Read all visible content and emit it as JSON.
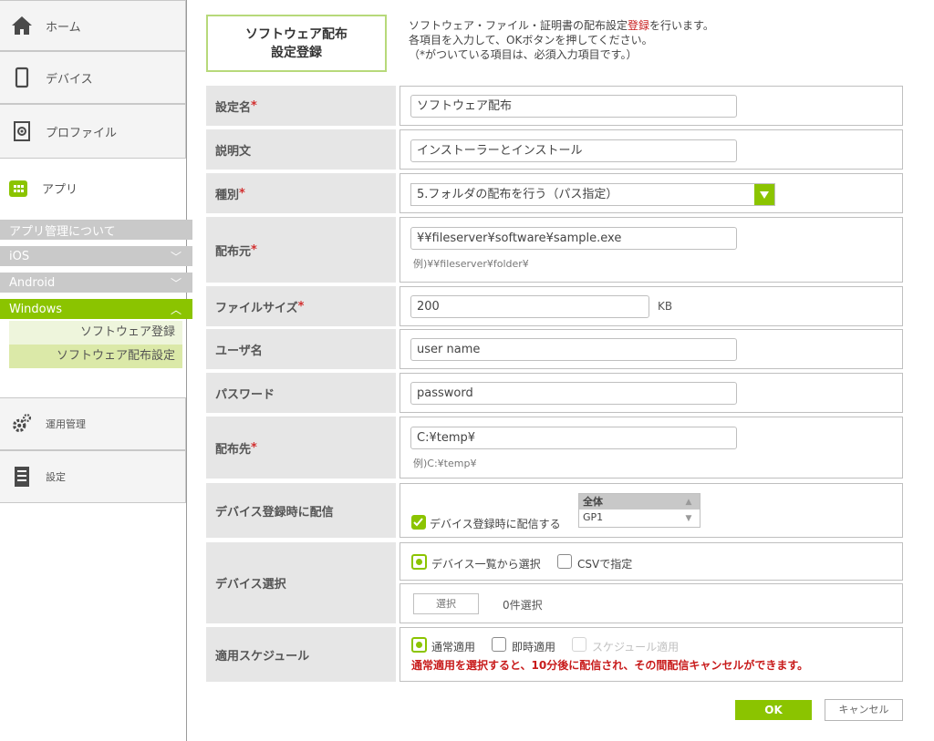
{
  "sidebar": {
    "home_label": "ホーム",
    "device_label": "デバイス",
    "profile_label": "プロファイル",
    "app_label": "アプリ",
    "app_items": [
      {
        "label": "アプリ管理について"
      },
      {
        "label": "iOS"
      },
      {
        "label": "Android"
      },
      {
        "label": "Windows"
      }
    ],
    "windows_sub": [
      {
        "label": "ソフトウェア登録"
      },
      {
        "label": "ソフトウェア配布設定"
      }
    ],
    "operation_label": "運用管理",
    "settings_label": "設定",
    "accent_color": "#8bc400"
  },
  "header": {
    "title_line1": "ソフトウェア配布",
    "title_line2": "設定登録",
    "intro_line1_pre": "ソフトウェア・ファイル・証明書の配布設定",
    "intro_line1_red": "登録",
    "intro_line1_post": "を行います。",
    "intro_line2": "各項目を入力して、OKボタンを押してください。",
    "intro_line3": "（*がついている項目は、必須入力項目です。）"
  },
  "form": {
    "setting_name": {
      "label": "設定名",
      "required": "*",
      "value": "ソフトウェア配布"
    },
    "description": {
      "label": "説明文",
      "value": "インストーラーとインストール"
    },
    "type": {
      "label": "種別",
      "required": "*",
      "value": "5.フォルダの配布を行う（パス指定）"
    },
    "source": {
      "label": "配布元",
      "required": "*",
      "value": "¥¥fileserver¥software¥sample.exe",
      "hint": "例)¥¥fileserver¥folder¥"
    },
    "file_size": {
      "label": "ファイルサイズ",
      "required": "*",
      "value": "200",
      "unit": "KB"
    },
    "username": {
      "label": "ユーザ名",
      "value": "user name"
    },
    "password": {
      "label": "パスワード",
      "value": "password"
    },
    "destination": {
      "label": "配布先",
      "required": "*",
      "value": "C:¥temp¥",
      "hint": "例)C:¥temp¥"
    },
    "deliver_on_register": {
      "label": "デバイス登録時に配信",
      "checkbox_label": "デバイス登録時に配信する",
      "checked": true,
      "groups": [
        "全体",
        "GP1"
      ]
    },
    "device_select": {
      "label": "デバイス選択",
      "option1": "デバイス一覧から選択",
      "option2": "CSVで指定",
      "select_button": "選択",
      "count_text": "0件選択"
    },
    "schedule": {
      "label": "適用スケジュール",
      "option1": "通常適用",
      "option2": "即時適用",
      "option3": "スケジュール適用",
      "warning": "通常適用を選択すると、10分後に配信され、その間配信キャンセルができます。"
    }
  },
  "buttons": {
    "ok": "OK",
    "cancel": "キャンセル"
  }
}
